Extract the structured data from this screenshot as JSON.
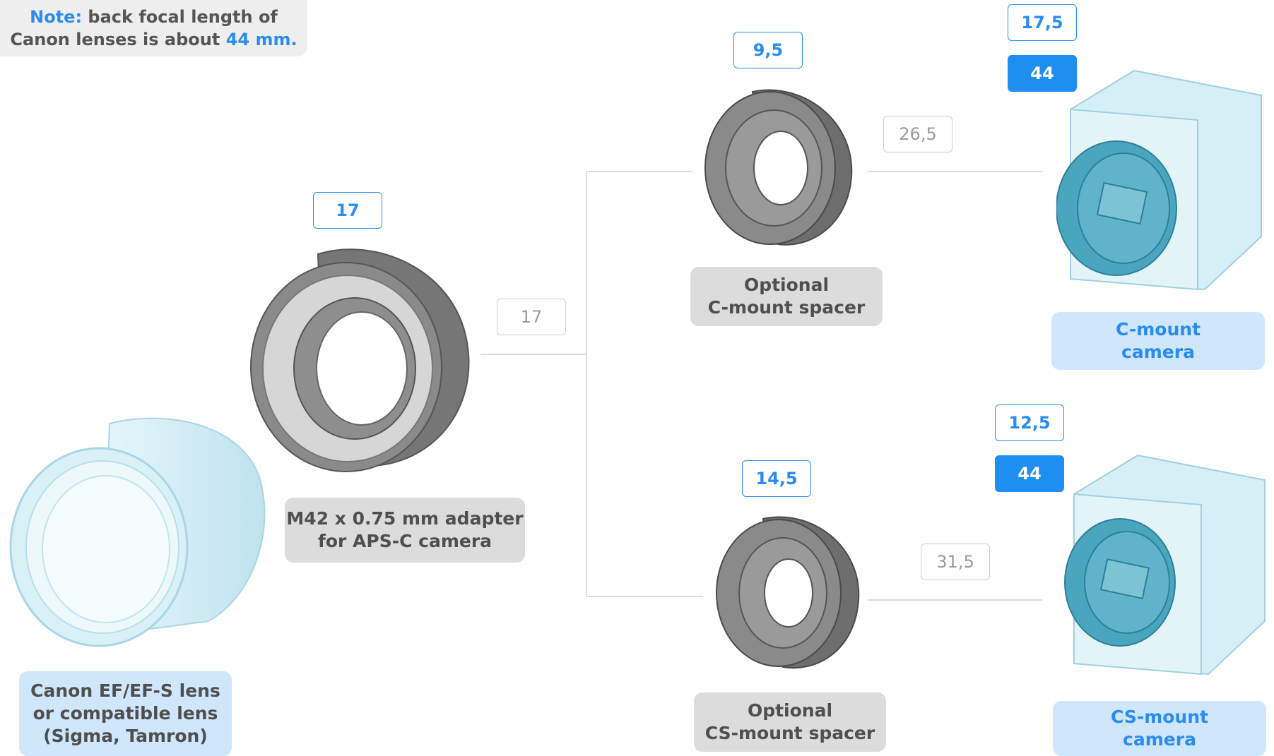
{
  "note": {
    "prefix": "Note:",
    "line1_rest": " back focal length of",
    "line2_start": "Canon lenses is about ",
    "line2_value": "44 mm."
  },
  "lens": {
    "line1": "Canon EF/EF-S lens",
    "line2": "or compatible lens",
    "line3": "(Sigma, Tamron)"
  },
  "adapter": {
    "line1": "M42 x 0.75 mm adapter",
    "line2": "for APS-C camera",
    "length_badge": "17",
    "connector_badge": "17"
  },
  "c_spacer": {
    "line1": "Optional",
    "line2": "C-mount spacer",
    "length_badge": "9,5",
    "connector_badge": "26,5"
  },
  "cs_spacer": {
    "line1": "Optional",
    "line2": "CS-mount spacer",
    "length_badge": "14,5",
    "connector_badge": "31,5"
  },
  "c_camera": {
    "line1": "C-mount",
    "line2": "camera",
    "flange_badge": "17,5",
    "total_badge": "44"
  },
  "cs_camera": {
    "line1": "CS-mount",
    "line2": "camera",
    "flange_badge": "12,5",
    "total_badge": "44"
  },
  "colors": {
    "accent": "#2a8cf0",
    "label_gray_bg": "#dcdcdc",
    "label_blue_bg": "#cfe6fb",
    "metal": "#6e6e6e",
    "camera_body": "#cfeaf2",
    "camera_lens": "#4aa6bf"
  }
}
